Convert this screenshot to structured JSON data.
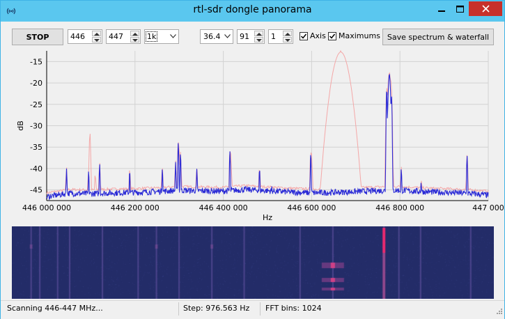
{
  "window": {
    "title": "rtl-sdr dongle panorama"
  },
  "toolbar": {
    "stop_label": "STOP",
    "freq_start": "446",
    "freq_end": "447",
    "step_value": "1k",
    "gain_value": "36.4",
    "integration_value": "91",
    "crop_value": "1",
    "axis_label": "Axis",
    "axis_checked": true,
    "maximums_label": "Maximums",
    "maximums_checked": true,
    "save_label": "Save spectrum & waterfall"
  },
  "status": {
    "scanning": "Scanning 446-447 MHz...",
    "step": "Step: 976.563 Hz",
    "fft_bins": "FFT bins: 1024"
  },
  "colors": {
    "titlebar": "#5ac7ef",
    "spectrum": "#2b2bd6",
    "maximums": "#f4a7a7",
    "waterfall_bg": "#232c68",
    "waterfall_hot": "#ff2f6c"
  },
  "chart_data": {
    "type": "line",
    "xlabel": "Hz",
    "ylabel": "dB",
    "xlim": [
      446000000,
      447000000
    ],
    "ylim": [
      -47.5,
      -12.5
    ],
    "xticks": [
      446000000,
      446200000,
      446400000,
      446600000,
      446800000,
      447000000
    ],
    "xtick_labels": [
      "446 000 000",
      "446 200 000",
      "446 400 000",
      "446 600 000",
      "446 800 000",
      "447 000"
    ],
    "yticks": [
      -45,
      -40,
      -35,
      -30,
      -25,
      -20,
      -15
    ],
    "ytick_labels": [
      "-45",
      "-40",
      "-35",
      "-30",
      "-25",
      "-20",
      "-15"
    ],
    "grid": true,
    "noise_floor": -45.6,
    "series": [
      {
        "values_x": [
          446000000,
          446050000,
          446100000,
          446150000,
          446200000,
          446250000,
          446300000,
          446350000,
          446400000,
          446450000,
          446500000,
          446550000,
          446600000,
          446650000,
          446700000,
          446750000,
          446800000,
          446850000,
          446900000,
          446950000,
          447000000
        ],
        "values_y": [
          -46.6,
          -45.8,
          -45.9,
          -45.7,
          -45.6,
          -45.4,
          -45.1,
          -45.2,
          -45.3,
          -44.9,
          -45.2,
          -45.5,
          -45.7,
          -45.6,
          -45.4,
          -45.2,
          -45.1,
          -45.4,
          -45.6,
          -45.8,
          -46.2
        ],
        "peaks": [
          {
            "x": 446045000,
            "y": -40
          },
          {
            "x": 446095000,
            "y": -40.5
          },
          {
            "x": 446120000,
            "y": -39
          },
          {
            "x": 446188000,
            "y": -40.5
          },
          {
            "x": 446262000,
            "y": -40
          },
          {
            "x": 446292000,
            "y": -38.5
          },
          {
            "x": 446298000,
            "y": -34
          },
          {
            "x": 446303000,
            "y": -36.5
          },
          {
            "x": 446340000,
            "y": -40
          },
          {
            "x": 446415000,
            "y": -36
          },
          {
            "x": 446482000,
            "y": -40
          },
          {
            "x": 446510000,
            "y": -44
          },
          {
            "x": 446598000,
            "y": -36.5
          },
          {
            "x": 446770000,
            "y": -21.5
          },
          {
            "x": 446776000,
            "y": -18
          },
          {
            "x": 446781000,
            "y": -23
          },
          {
            "x": 446803000,
            "y": -40
          },
          {
            "x": 446848000,
            "y": -43
          },
          {
            "x": 446952000,
            "y": -37
          }
        ]
      },
      {
        "name_key": "maximums",
        "peaks": [
          {
            "x": 446098000,
            "y": -32
          },
          {
            "x": 446110000,
            "y": -41.5
          },
          {
            "x": 446666000,
            "y": -12.8
          },
          {
            "x": 446770000,
            "y": -27
          },
          {
            "x": 446300000,
            "y": -36
          },
          {
            "x": 446417000,
            "y": -37
          },
          {
            "x": 446600000,
            "y": -37
          },
          {
            "x": 446780000,
            "y": -20
          }
        ]
      }
    ],
    "waterfall_lines": [
      446040000,
      446058000,
      446095000,
      446120000,
      446188000,
      446262000,
      446300000,
      446347000,
      446415000,
      446482000,
      446598000,
      446666000,
      446772000,
      446803000,
      446848000,
      446952000
    ]
  }
}
